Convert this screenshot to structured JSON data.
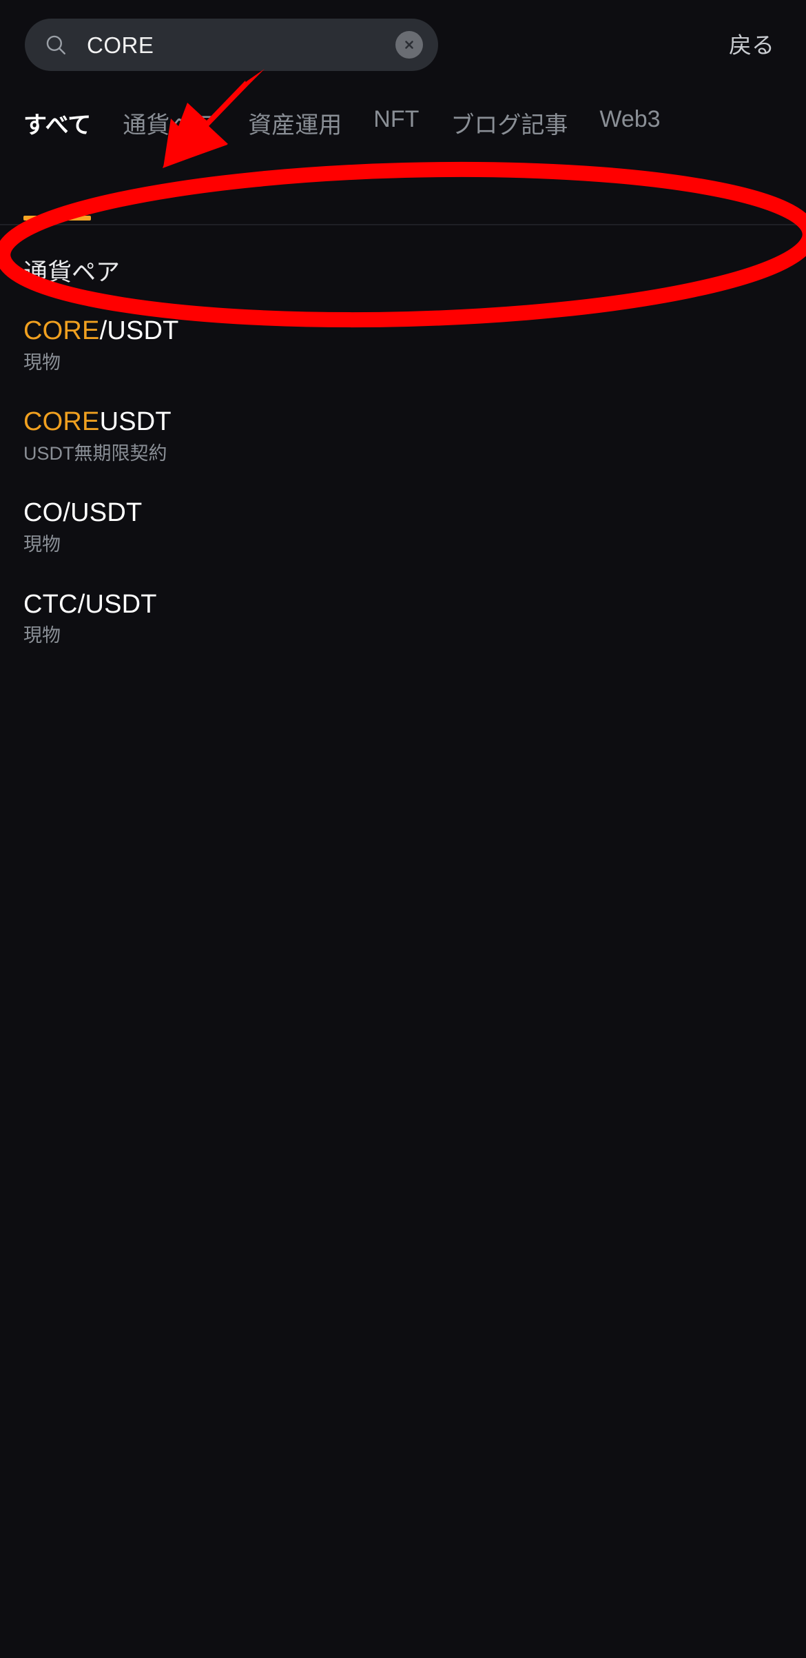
{
  "app": {
    "background_color": "#0d0d11",
    "accent_color": "#f0a020",
    "annotation_color": "#ff0000"
  },
  "search": {
    "icon": "search-icon",
    "value": "CORE",
    "placeholder": "CORE",
    "clear_icon": "close-circle-icon",
    "back_label": "戻る"
  },
  "tabs": [
    {
      "label": "すべて",
      "active": true
    },
    {
      "label": "通貨ペア",
      "active": false
    },
    {
      "label": "資産運用",
      "active": false
    },
    {
      "label": "NFT",
      "active": false
    },
    {
      "label": "ブログ記事",
      "active": false
    },
    {
      "label": "Web3",
      "active": false
    }
  ],
  "results": {
    "section_title": "通貨ペア",
    "items": [
      {
        "match": "CORE",
        "rest": "/USDT",
        "subtitle": "現物"
      },
      {
        "match": "CORE",
        "rest": "USDT",
        "subtitle": "USDT無期限契約"
      },
      {
        "match": "",
        "rest": "CO/USDT",
        "subtitle": "現物"
      },
      {
        "match": "",
        "rest": "CTC/USDT",
        "subtitle": "現物"
      }
    ]
  },
  "annotations": {
    "arrow": {
      "name": "red-arrow-annotation",
      "color": "#ff0000"
    },
    "ellipse": {
      "name": "red-ellipse-annotation",
      "color": "#ff0000",
      "target": "CORE/USDT"
    }
  }
}
